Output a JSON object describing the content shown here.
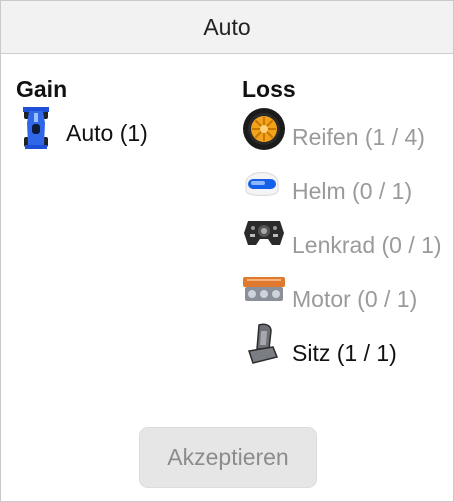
{
  "window": {
    "title": "Auto"
  },
  "gain": {
    "heading": "Gain",
    "items": [
      {
        "icon": "race-car-icon",
        "label": "Auto (1)"
      }
    ]
  },
  "loss": {
    "heading": "Loss",
    "items": [
      {
        "icon": "tire-icon",
        "label": "Reifen (1 / 4)",
        "state": "muted"
      },
      {
        "icon": "helmet-icon",
        "label": "Helm (0 / 1)",
        "state": "muted"
      },
      {
        "icon": "steering-wheel-icon",
        "label": "Lenkrad (0 / 1)",
        "state": "muted"
      },
      {
        "icon": "engine-icon",
        "label": "Motor (0 / 1)",
        "state": "muted"
      },
      {
        "icon": "seat-icon",
        "label": "Sitz (1 / 1)",
        "state": "normal"
      }
    ]
  },
  "actions": {
    "accept_label": "Akzeptieren",
    "accept_enabled": false
  },
  "colors": {
    "muted_text": "#9a9a9a",
    "button_bg": "#e6e6e6",
    "titlebar_bg": "#f2f2f2"
  }
}
